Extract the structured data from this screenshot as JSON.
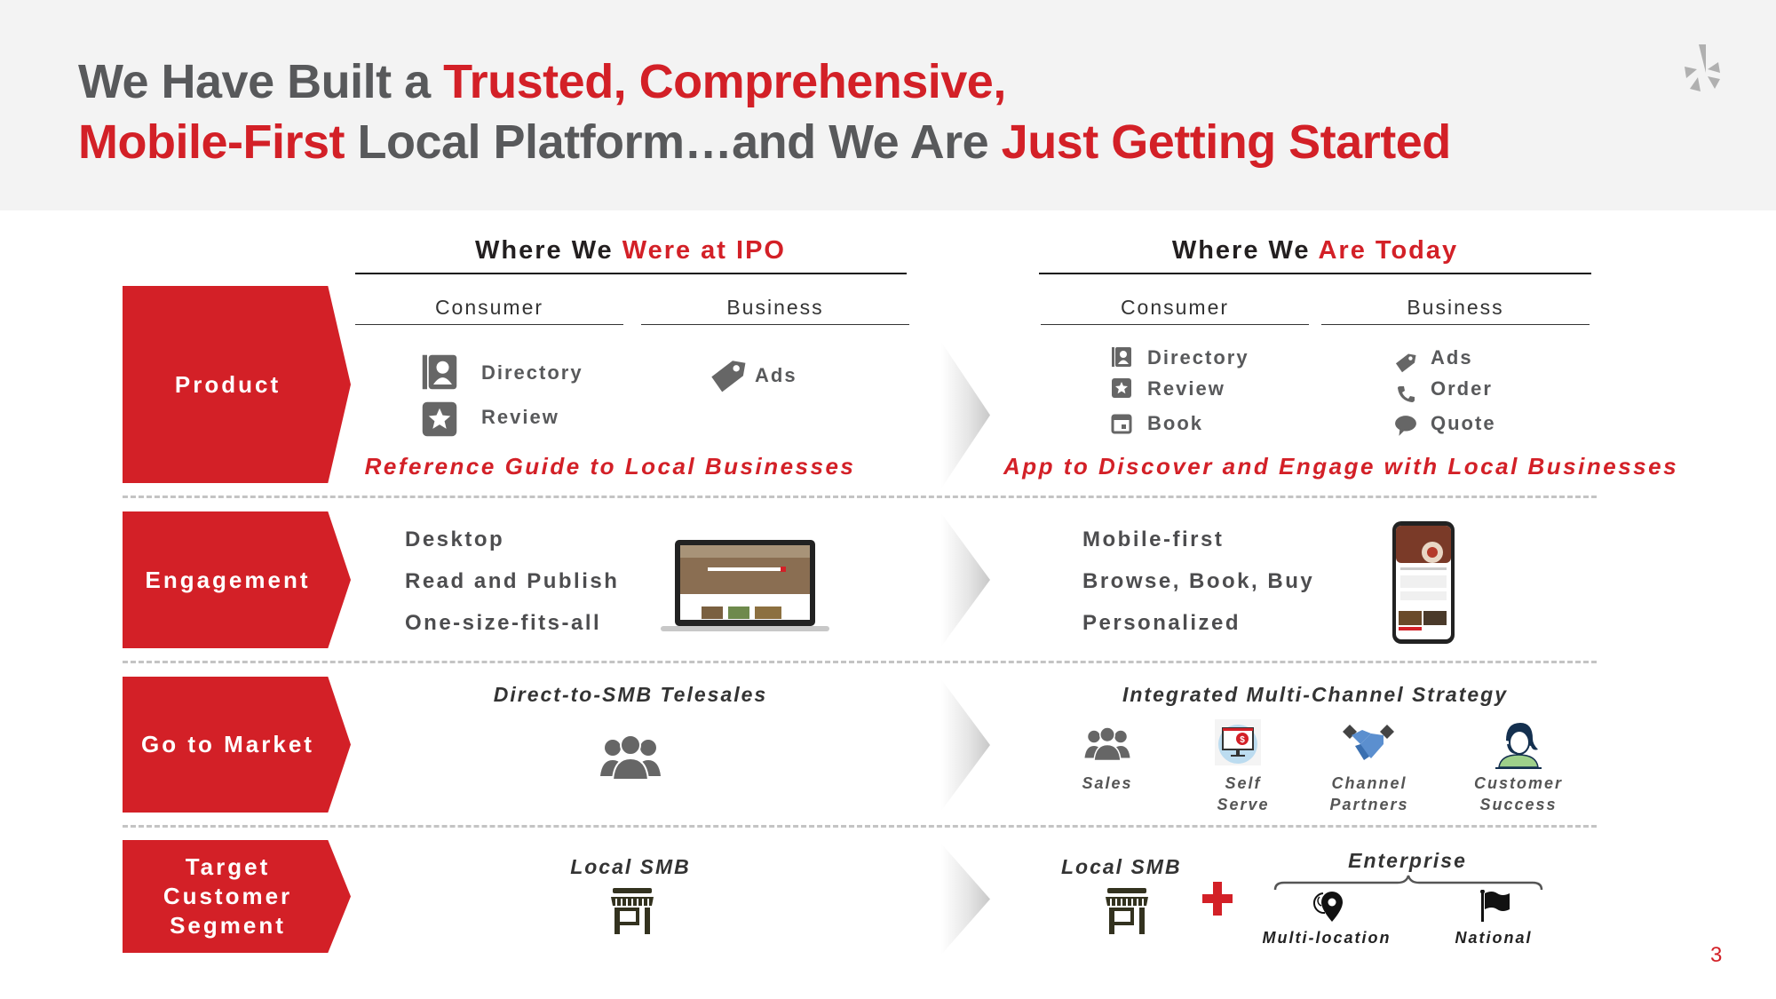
{
  "slide": {
    "title": {
      "line1": [
        {
          "text": "We Have Built a ",
          "accent": false
        },
        {
          "text": "Trusted, Comprehensive,",
          "accent": true
        }
      ],
      "line2": [
        {
          "text": "Mobile-First",
          "accent": true
        },
        {
          "text": " Local Platform…and We Are ",
          "accent": false
        },
        {
          "text": "Just Getting Started",
          "accent": true
        }
      ]
    },
    "logo_icon": "yelp-burst-icon",
    "page_number": "3",
    "colors": {
      "accent": "#d32027",
      "text": "#58595b",
      "header_bg": "#f3f3f3"
    }
  },
  "columns": {
    "ipo": {
      "prefix": "Where We ",
      "accent": "Were at IPO",
      "consumer": "Consumer",
      "business": "Business"
    },
    "today": {
      "prefix": "Where We ",
      "accent": "Are Today",
      "consumer": "Consumer",
      "business": "Business"
    }
  },
  "rows": {
    "product": {
      "label": "Product",
      "ipo": {
        "consumer": [
          {
            "icon": "directory-icon",
            "label": "Directory"
          },
          {
            "icon": "review-star-icon",
            "label": "Review"
          }
        ],
        "business": [
          {
            "icon": "tag-icon",
            "label": "Ads"
          }
        ],
        "tagline": "Reference Guide to Local Businesses"
      },
      "today": {
        "consumer": [
          {
            "icon": "directory-icon",
            "label": "Directory"
          },
          {
            "icon": "review-star-icon",
            "label": "Review"
          },
          {
            "icon": "calendar-icon",
            "label": "Book"
          }
        ],
        "business": [
          {
            "icon": "tag-icon",
            "label": "Ads"
          },
          {
            "icon": "phone-icon",
            "label": "Order"
          },
          {
            "icon": "speech-bubble-icon",
            "label": "Quote"
          }
        ],
        "tagline": "App to Discover and Engage with Local Businesses"
      }
    },
    "engagement": {
      "label": "Engagement",
      "ipo": {
        "items": [
          "Desktop",
          "Read and Publish",
          "One-size-fits-all"
        ],
        "image": "laptop-image"
      },
      "today": {
        "items": [
          "Mobile-first",
          "Browse, Book, Buy",
          "Personalized"
        ],
        "image": "phone-image"
      }
    },
    "go_to_market": {
      "label": "Go to Market",
      "ipo": {
        "heading": "Direct-to-SMB Telesales",
        "icon": "people-group-icon"
      },
      "today": {
        "heading": "Integrated Multi-Channel Strategy",
        "channels": [
          {
            "icon": "people-group-icon",
            "label1": "Sales",
            "label2": ""
          },
          {
            "icon": "monitor-dollar-icon",
            "label1": "Self",
            "label2": "Serve"
          },
          {
            "icon": "handshake-icon",
            "label1": "Channel",
            "label2": "Partners"
          },
          {
            "icon": "headset-agent-icon",
            "label1": "Customer",
            "label2": "Success"
          }
        ]
      }
    },
    "target": {
      "label_lines": [
        "Target",
        "Customer",
        "Segment"
      ],
      "ipo": {
        "heading": "Local SMB",
        "icon": "storefront-icon"
      },
      "today": {
        "smb": "Local SMB",
        "plus": "+",
        "enterprise": "Enterprise",
        "multi_location": "Multi-location",
        "national": "National"
      }
    }
  }
}
